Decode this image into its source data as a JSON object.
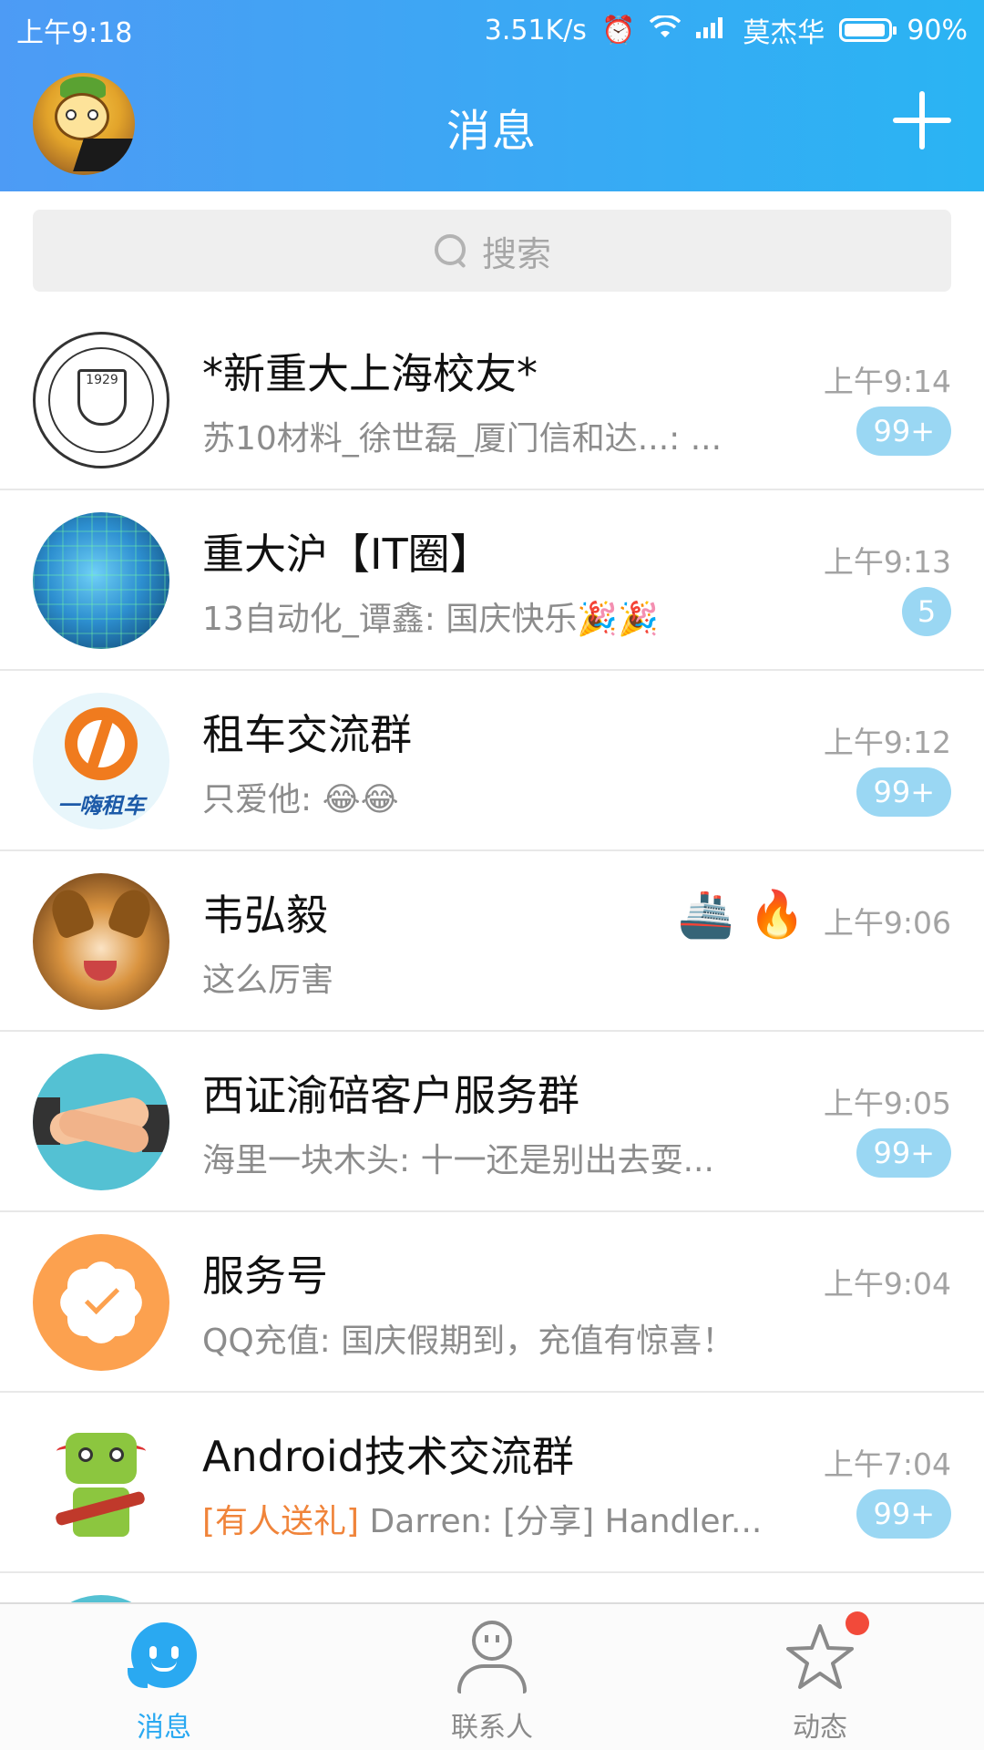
{
  "status_bar": {
    "time": "上午9:18",
    "net_speed": "3.51K/s",
    "carrier": "莫杰华",
    "battery": "90%",
    "alarm_icon": "alarm-icon",
    "wifi_icon": "wifi-icon",
    "signal_icon": "signal-icon"
  },
  "header": {
    "title": "消息",
    "plus_icon": "plus-icon"
  },
  "search": {
    "placeholder": "搜索"
  },
  "conversations": [
    {
      "name": "*新重大上海校友*",
      "preview": "苏10材料_徐世磊_厦门信和达...: ...",
      "time": "上午9:14",
      "badge": "99+"
    },
    {
      "name": "重大沪【IT圈】",
      "preview": "13自动化_谭鑫: 国庆快乐🎉🎉",
      "time": "上午9:13",
      "badge": "5"
    },
    {
      "name": "租车交流群",
      "preview": "只爱他: 😂😂",
      "time": "上午9:12",
      "badge": "99+",
      "avatar_text": "一嗨租车"
    },
    {
      "name": "韦弘毅",
      "preview": "这么厉害",
      "time": "上午9:06",
      "flags": [
        "🚢",
        "🔥"
      ]
    },
    {
      "name": "西证渝碚客户服务群",
      "preview": "海里一块木头: 十一还是别出去耍...",
      "time": "上午9:05",
      "badge": "99+"
    },
    {
      "name": "服务号",
      "preview": "QQ充值: 国庆假期到，充值有惊喜！",
      "time": "上午9:04"
    },
    {
      "name": "Android技术交流群",
      "preview_highlight": "[有人送礼]",
      "preview": " Darren: [分享] Handler...",
      "time": "上午7:04",
      "badge": "99+"
    }
  ],
  "tabs": {
    "messages": "消息",
    "contacts": "联系人",
    "feed": "动态"
  },
  "colors": {
    "header_start": "#4d9bf5",
    "header_end": "#2ab4f3",
    "badge": "#9ad7f3",
    "active_tab": "#2aa9f1",
    "highlight": "#f0843a",
    "notification_dot": "#f24a3a"
  }
}
